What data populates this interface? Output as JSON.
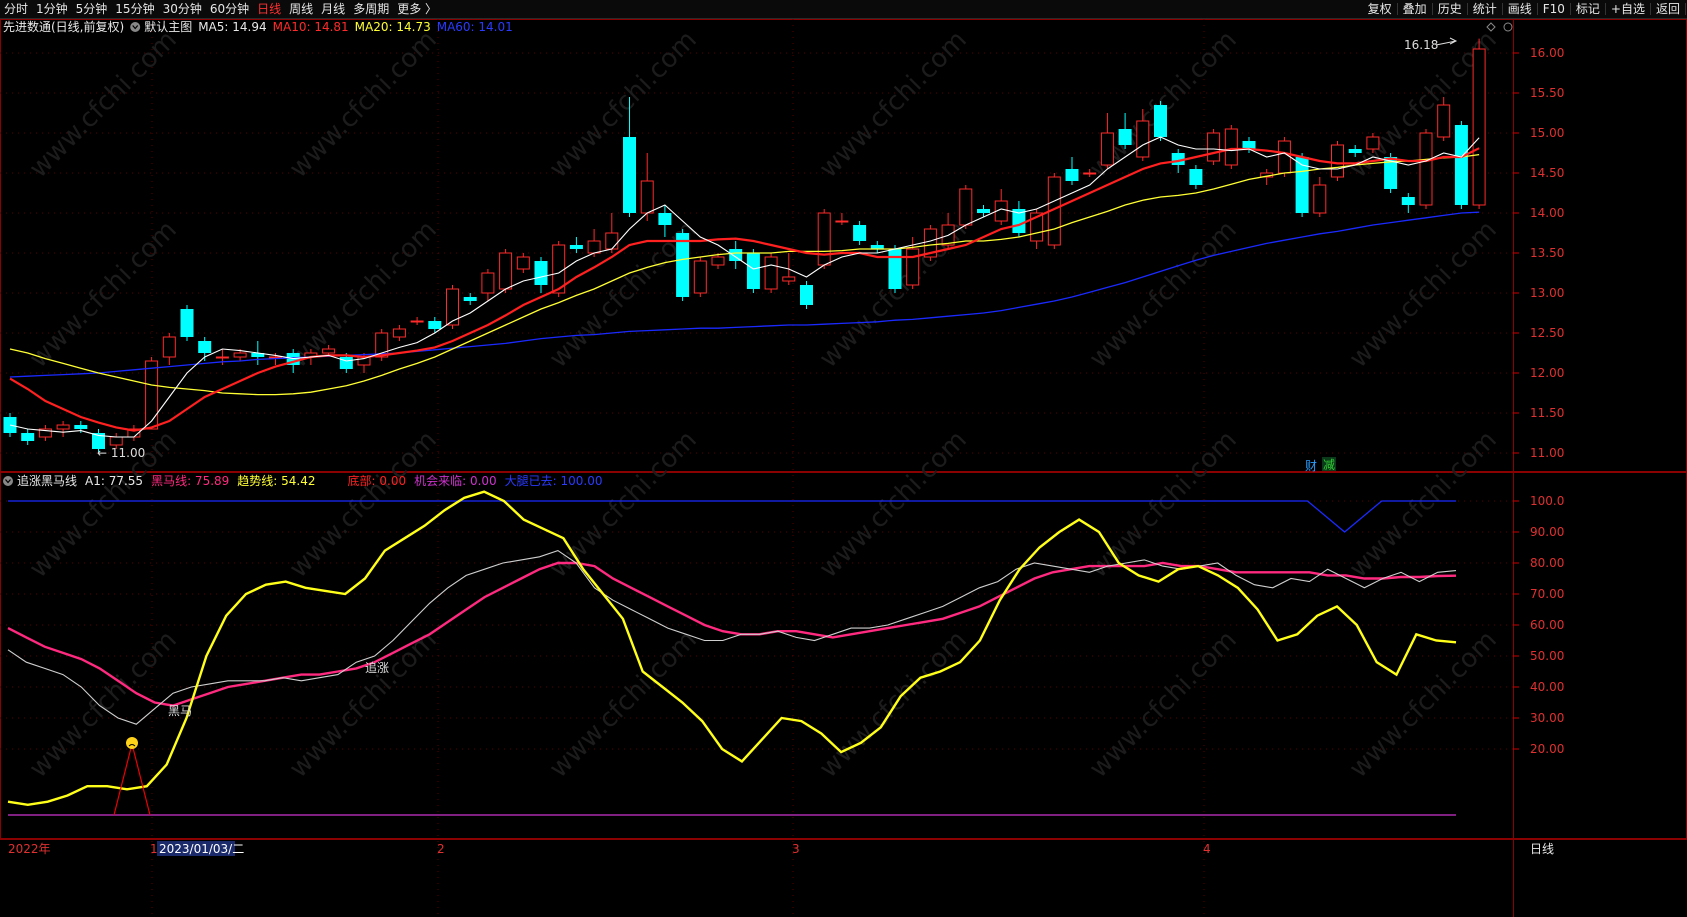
{
  "toolbar": {
    "left": [
      "分时",
      "1分钟",
      "5分钟",
      "15分钟",
      "30分钟",
      "60分钟",
      "日线",
      "周线",
      "月线",
      "多周期",
      "更多 〉"
    ],
    "active": "日线",
    "right": [
      "复权",
      "叠加",
      "历史",
      "统计",
      "画线",
      "F10",
      "+自选",
      "返回"
    ],
    "right_extra": "标记"
  },
  "main_header": {
    "stock": "先进数通(日线,前复权)",
    "template": "默认主图",
    "ma5": "MA5: 14.94",
    "ma10": "MA10: 14.81",
    "ma20": "MA20: 14.73",
    "ma60": "MA60: 14.01"
  },
  "ind_header": {
    "name": "追涨黑马线",
    "a1": "A1: 77.55",
    "heima": "黑马线: 75.89",
    "trend": "趋势线: 54.42",
    "bottom": "底部: 0.00",
    "chance": "机会来临: 0.00",
    "surge": "大腿已去: 100.00"
  },
  "colors": {
    "up": "#ff2a2a",
    "down": "#00ffff",
    "ma5": "#ffffff",
    "ma10": "#ff2020",
    "ma20": "#ffff33",
    "ma60": "#1a2aff"
  },
  "labels": {
    "high_mark": "16.18",
    "low_mark": "11.00",
    "cai": "财",
    "jian": "减",
    "zhuizhang": "追涨",
    "heima": "黑马",
    "period_button": "日线",
    "watermark": "www.cfchi.com"
  },
  "price_axis": [
    "16.00",
    "15.50",
    "15.00",
    "14.50",
    "14.00",
    "13.50",
    "13.00",
    "12.50",
    "12.00",
    "11.50",
    "11.00"
  ],
  "ind_axis": [
    "100.0",
    "90.00",
    "80.00",
    "70.00",
    "60.00",
    "50.00",
    "40.00",
    "30.00",
    "20.00"
  ],
  "date_axis": {
    "year": "2022年",
    "current": "2023/01/03/二",
    "m1": "1",
    "m2": "2",
    "m3": "3",
    "m4": "4"
  },
  "chart_data": {
    "type": "candlestick",
    "candles": [
      [
        11.45,
        11.25,
        11.5,
        11.2
      ],
      [
        11.25,
        11.15,
        11.3,
        11.1
      ],
      [
        11.2,
        11.3,
        11.35,
        11.15
      ],
      [
        11.3,
        11.35,
        11.4,
        11.2
      ],
      [
        11.35,
        11.3,
        11.4,
        11.25
      ],
      [
        11.25,
        11.05,
        11.3,
        11.0
      ],
      [
        11.1,
        11.2,
        11.25,
        11.05
      ],
      [
        11.2,
        11.3,
        11.35,
        11.15
      ],
      [
        11.3,
        12.15,
        12.2,
        11.3
      ],
      [
        12.2,
        12.45,
        12.5,
        12.1
      ],
      [
        12.8,
        12.45,
        12.85,
        12.4
      ],
      [
        12.4,
        12.25,
        12.45,
        12.15
      ],
      [
        12.2,
        12.2,
        12.3,
        12.1
      ],
      [
        12.2,
        12.25,
        12.3,
        12.15
      ],
      [
        12.25,
        12.2,
        12.4,
        12.1
      ],
      [
        12.2,
        12.2,
        12.25,
        12.1
      ],
      [
        12.25,
        12.1,
        12.3,
        12.0
      ],
      [
        12.2,
        12.25,
        12.3,
        12.1
      ],
      [
        12.25,
        12.3,
        12.35,
        12.2
      ],
      [
        12.2,
        12.05,
        12.25,
        12.0
      ],
      [
        12.1,
        12.2,
        12.25,
        12.0
      ],
      [
        12.2,
        12.5,
        12.55,
        12.15
      ],
      [
        12.45,
        12.55,
        12.6,
        12.4
      ],
      [
        12.65,
        12.65,
        12.7,
        12.6
      ],
      [
        12.65,
        12.55,
        12.7,
        12.5
      ],
      [
        12.6,
        13.05,
        13.1,
        12.55
      ],
      [
        12.95,
        12.9,
        13.0,
        12.85
      ],
      [
        13.0,
        13.25,
        13.3,
        12.9
      ],
      [
        13.05,
        13.5,
        13.55,
        13.0
      ],
      [
        13.3,
        13.45,
        13.5,
        13.25
      ],
      [
        13.4,
        13.1,
        13.45,
        13.0
      ],
      [
        13.0,
        13.6,
        13.65,
        12.95
      ],
      [
        13.6,
        13.55,
        13.7,
        13.5
      ],
      [
        13.5,
        13.65,
        13.8,
        13.45
      ],
      [
        13.55,
        13.75,
        14.0,
        13.5
      ],
      [
        14.95,
        14.0,
        15.45,
        13.95
      ],
      [
        14.0,
        14.4,
        14.75,
        13.9
      ],
      [
        14.0,
        13.85,
        14.1,
        13.7
      ],
      [
        13.75,
        12.95,
        13.8,
        12.9
      ],
      [
        13.0,
        13.4,
        13.45,
        12.95
      ],
      [
        13.35,
        13.45,
        13.5,
        13.3
      ],
      [
        13.55,
        13.4,
        13.65,
        13.3
      ],
      [
        13.5,
        13.05,
        13.55,
        13.0
      ],
      [
        13.05,
        13.45,
        13.5,
        13.0
      ],
      [
        13.15,
        13.2,
        13.5,
        13.1
      ],
      [
        13.1,
        12.85,
        13.15,
        12.8
      ],
      [
        13.35,
        14.0,
        14.05,
        13.3
      ],
      [
        13.9,
        13.9,
        14.0,
        13.85
      ],
      [
        13.85,
        13.65,
        13.9,
        13.6
      ],
      [
        13.6,
        13.55,
        13.65,
        13.5
      ],
      [
        13.55,
        13.05,
        13.6,
        13.0
      ],
      [
        13.1,
        13.55,
        13.7,
        13.05
      ],
      [
        13.45,
        13.8,
        13.85,
        13.4
      ],
      [
        13.6,
        13.85,
        14.0,
        13.55
      ],
      [
        13.85,
        14.3,
        14.35,
        13.8
      ],
      [
        14.05,
        14.0,
        14.1,
        13.95
      ],
      [
        13.9,
        14.15,
        14.3,
        13.85
      ],
      [
        14.05,
        13.75,
        14.15,
        13.7
      ],
      [
        13.65,
        14.0,
        14.05,
        13.55
      ],
      [
        13.6,
        14.45,
        14.5,
        13.55
      ],
      [
        14.55,
        14.4,
        14.7,
        14.35
      ],
      [
        14.5,
        14.5,
        14.55,
        14.45
      ],
      [
        14.6,
        15.0,
        15.25,
        14.55
      ],
      [
        15.05,
        14.85,
        15.25,
        14.8
      ],
      [
        14.7,
        15.15,
        15.3,
        14.65
      ],
      [
        15.35,
        14.95,
        15.4,
        14.9
      ],
      [
        14.75,
        14.6,
        14.8,
        14.5
      ],
      [
        14.55,
        14.35,
        14.6,
        14.3
      ],
      [
        14.65,
        15.0,
        15.05,
        14.6
      ],
      [
        14.6,
        15.05,
        15.1,
        14.55
      ],
      [
        14.9,
        14.8,
        14.95,
        14.75
      ],
      [
        14.45,
        14.5,
        14.55,
        14.35
      ],
      [
        14.5,
        14.9,
        14.95,
        14.45
      ],
      [
        14.7,
        14.0,
        14.75,
        13.95
      ],
      [
        14.0,
        14.35,
        14.45,
        13.95
      ],
      [
        14.45,
        14.85,
        14.9,
        14.4
      ],
      [
        14.8,
        14.75,
        14.85,
        14.7
      ],
      [
        14.8,
        14.95,
        15.0,
        14.75
      ],
      [
        14.7,
        14.3,
        14.75,
        14.25
      ],
      [
        14.2,
        14.1,
        14.25,
        14.0
      ],
      [
        14.1,
        15.0,
        15.05,
        14.05
      ],
      [
        14.95,
        15.35,
        15.45,
        14.9
      ],
      [
        15.1,
        14.1,
        15.15,
        14.05
      ],
      [
        14.1,
        16.05,
        16.18,
        14.05
      ]
    ],
    "ma5": [
      11.35,
      11.3,
      11.28,
      11.26,
      11.28,
      11.22,
      11.2,
      11.2,
      11.4,
      11.7,
      12.0,
      12.2,
      12.3,
      12.28,
      12.25,
      12.22,
      12.18,
      12.2,
      12.22,
      12.15,
      12.18,
      12.25,
      12.32,
      12.38,
      12.5,
      12.65,
      12.75,
      12.9,
      13.05,
      13.15,
      13.2,
      13.25,
      13.4,
      13.5,
      13.55,
      13.8,
      14.0,
      14.1,
      13.9,
      13.7,
      13.6,
      13.45,
      13.3,
      13.35,
      13.3,
      13.2,
      13.35,
      13.45,
      13.5,
      13.5,
      13.55,
      13.6,
      13.65,
      13.72,
      13.85,
      13.95,
      14.05,
      14.0,
      14.05,
      14.15,
      14.25,
      14.35,
      14.55,
      14.7,
      14.85,
      14.95,
      14.85,
      14.8,
      14.8,
      14.78,
      14.8,
      14.7,
      14.75,
      14.6,
      14.55,
      14.55,
      14.6,
      14.7,
      14.65,
      14.6,
      14.65,
      14.75,
      14.7,
      14.94
    ],
    "ma10": [
      11.93,
      11.8,
      11.65,
      11.55,
      11.45,
      11.38,
      11.32,
      11.28,
      11.32,
      11.4,
      11.55,
      11.7,
      11.8,
      11.9,
      12.0,
      12.08,
      12.14,
      12.2,
      12.22,
      12.22,
      12.2,
      12.22,
      12.25,
      12.28,
      12.32,
      12.4,
      12.5,
      12.6,
      12.72,
      12.85,
      12.95,
      13.05,
      13.2,
      13.32,
      13.45,
      13.6,
      13.65,
      13.65,
      13.65,
      13.65,
      13.67,
      13.68,
      13.65,
      13.6,
      13.55,
      13.5,
      13.48,
      13.5,
      13.5,
      13.45,
      13.45,
      13.45,
      13.5,
      13.55,
      13.6,
      13.7,
      13.8,
      13.85,
      13.95,
      14.05,
      14.15,
      14.25,
      14.35,
      14.45,
      14.55,
      14.62,
      14.65,
      14.7,
      14.75,
      14.8,
      14.8,
      14.78,
      14.75,
      14.7,
      14.65,
      14.62,
      14.62,
      14.65,
      14.68,
      14.65,
      14.65,
      14.7,
      14.7,
      14.81
    ],
    "ma20": [
      12.3,
      12.25,
      12.18,
      12.12,
      12.06,
      12.0,
      11.95,
      11.9,
      11.85,
      11.82,
      11.8,
      11.78,
      11.75,
      11.74,
      11.73,
      11.73,
      11.74,
      11.76,
      11.8,
      11.84,
      11.9,
      11.97,
      12.05,
      12.12,
      12.2,
      12.3,
      12.4,
      12.5,
      12.6,
      12.7,
      12.8,
      12.88,
      12.97,
      13.05,
      13.15,
      13.25,
      13.32,
      13.38,
      13.42,
      13.45,
      13.48,
      13.5,
      13.5,
      13.5,
      13.52,
      13.52,
      13.52,
      13.53,
      13.55,
      13.55,
      13.55,
      13.57,
      13.6,
      13.62,
      13.65,
      13.65,
      13.67,
      13.7,
      13.75,
      13.8,
      13.88,
      13.95,
      14.02,
      14.1,
      14.16,
      14.2,
      14.22,
      14.25,
      14.3,
      14.36,
      14.42,
      14.46,
      14.5,
      14.52,
      14.55,
      14.57,
      14.6,
      14.62,
      14.64,
      14.65,
      14.67,
      14.69,
      14.7,
      14.73
    ],
    "ma60": [
      11.95,
      11.96,
      11.97,
      11.98,
      11.99,
      12.0,
      12.02,
      12.04,
      12.06,
      12.08,
      12.1,
      12.12,
      12.14,
      12.15,
      12.17,
      12.18,
      12.19,
      12.2,
      12.21,
      12.22,
      12.23,
      12.24,
      12.25,
      12.27,
      12.29,
      12.31,
      12.33,
      12.35,
      12.37,
      12.4,
      12.43,
      12.45,
      12.47,
      12.48,
      12.5,
      12.52,
      12.53,
      12.54,
      12.55,
      12.56,
      12.56,
      12.57,
      12.58,
      12.59,
      12.6,
      12.6,
      12.61,
      12.62,
      12.63,
      12.64,
      12.66,
      12.67,
      12.69,
      12.71,
      12.73,
      12.75,
      12.78,
      12.82,
      12.86,
      12.9,
      12.95,
      13.01,
      13.07,
      13.13,
      13.2,
      13.27,
      13.34,
      13.41,
      13.47,
      13.52,
      13.57,
      13.62,
      13.66,
      13.7,
      13.74,
      13.77,
      13.81,
      13.85,
      13.88,
      13.91,
      13.94,
      13.97,
      14.0,
      14.01
    ],
    "ind_a1": [
      52,
      48,
      46,
      44,
      40,
      34,
      30,
      28,
      33,
      38,
      40,
      41,
      42,
      42,
      42,
      43,
      42,
      43,
      44,
      48,
      50,
      55,
      61,
      67,
      72,
      76,
      78,
      80,
      81,
      82,
      84,
      80,
      72,
      68,
      65,
      62,
      59,
      57,
      55,
      55,
      57,
      57,
      58,
      56,
      55,
      57,
      59,
      59,
      60,
      62,
      64,
      66,
      69,
      72,
      74,
      78,
      80,
      79,
      78,
      77,
      79,
      80,
      81,
      79,
      78,
      79,
      80,
      76,
      73,
      72,
      75,
      74,
      78,
      75,
      72,
      75,
      77,
      74,
      77,
      77.55
    ],
    "ind_heima": [
      59,
      56,
      53,
      51,
      49,
      46,
      42,
      38,
      35,
      34,
      36,
      38,
      40,
      41,
      42,
      43,
      44,
      44,
      45,
      46,
      48,
      51,
      54,
      57,
      61,
      65,
      69,
      72,
      75,
      78,
      80,
      80,
      79,
      75,
      72,
      69,
      66,
      63,
      60,
      58,
      57,
      57,
      58,
      58,
      57,
      56,
      57,
      58,
      59,
      60,
      61,
      62,
      64,
      66,
      69,
      72,
      75,
      77,
      78,
      79,
      79,
      79,
      79,
      80,
      79,
      79,
      78,
      77,
      77,
      77,
      77,
      77,
      76,
      76,
      75,
      75,
      75.5,
      75.5,
      75.8,
      75.89
    ],
    "ind_trend": [
      3,
      2,
      3,
      5,
      8,
      8,
      7,
      8,
      15,
      30,
      50,
      63,
      70,
      73,
      74,
      72,
      71,
      70,
      75,
      84,
      88,
      92,
      97,
      101,
      103,
      100,
      94,
      91,
      88,
      78,
      70,
      62,
      45,
      40,
      35,
      29,
      20,
      16,
      23,
      30,
      29,
      25,
      19,
      22,
      27,
      37,
      43,
      45,
      48,
      55,
      68,
      78,
      85,
      90,
      94,
      90,
      80,
      76,
      74,
      78,
      79,
      76,
      72,
      65,
      55,
      57,
      63,
      66,
      60,
      48,
      44,
      57,
      55,
      54.42
    ],
    "ind_blue": [
      100,
      100,
      100,
      100,
      100,
      100,
      100,
      100,
      100,
      100,
      100,
      100,
      100,
      100,
      100,
      100,
      100,
      100,
      100,
      100,
      100,
      100,
      100,
      100,
      100,
      100,
      100,
      100,
      100,
      100,
      100,
      100,
      100,
      100,
      100,
      100,
      90,
      100,
      100,
      100
    ],
    "ind_magenta": 0
  }
}
